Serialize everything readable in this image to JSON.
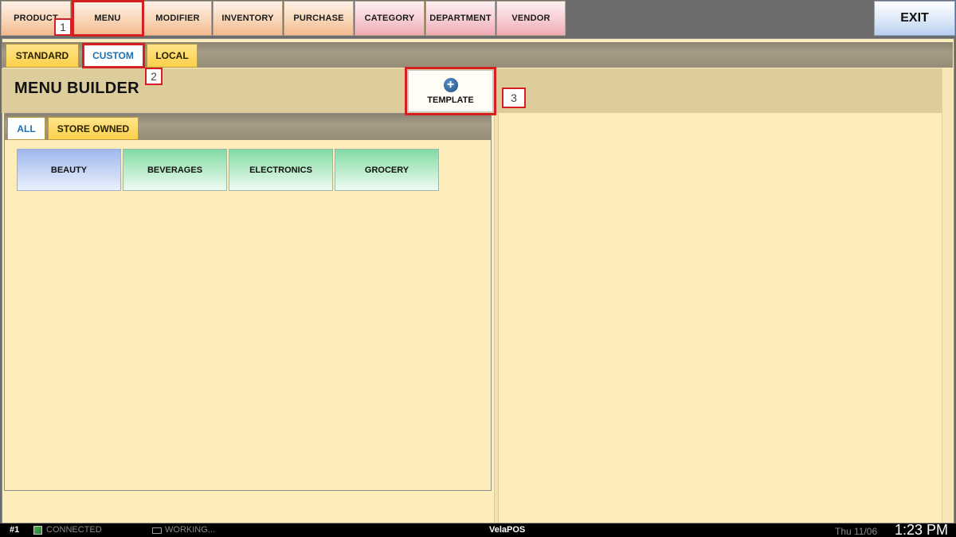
{
  "nav": {
    "items": [
      "PRODUCT",
      "MENU",
      "MODIFIER",
      "INVENTORY",
      "PURCHASE",
      "CATEGORY",
      "DEPARTMENT",
      "VENDOR"
    ],
    "exit_label": "EXIT"
  },
  "tabs": [
    "STANDARD",
    "CUSTOM",
    "LOCAL"
  ],
  "page_title": "MENU BUILDER",
  "template_button": "TEMPLATE",
  "subtabs": [
    "ALL",
    "STORE OWNED"
  ],
  "categories": [
    "BEAUTY",
    "BEVERAGES",
    "ELECTRONICS",
    "GROCERY"
  ],
  "callouts": [
    "1",
    "2",
    "3"
  ],
  "status": {
    "terminal": "#1",
    "connection": "CONNECTED",
    "working": "WORKING...",
    "app_name": "VelaPOS",
    "date": "Thu 11/06",
    "time": "1:23 PM"
  },
  "colors": {
    "accent_red": "#d42020",
    "panel_bg": "#fdedbb",
    "header_bg": "#ddcd9c",
    "tab_active_text": "#1d6fb3"
  }
}
